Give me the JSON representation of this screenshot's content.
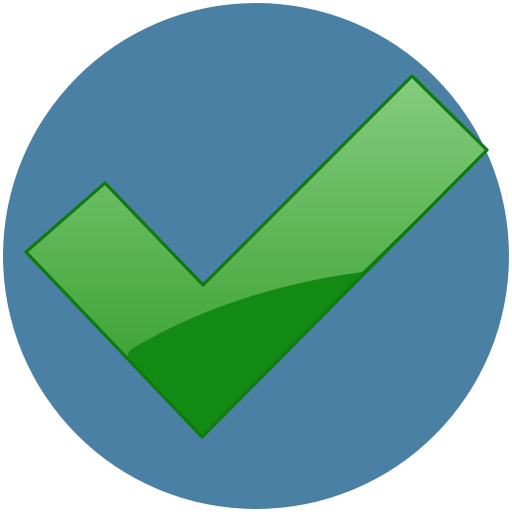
{
  "icon": {
    "name": "checkmark-icon",
    "colors": {
      "circle_fill": "#4a80a4",
      "check_light": "#86cc80",
      "check_mid": "#55b04c",
      "check_dark": "#138a14",
      "check_outline": "#0e7a10",
      "page_background": "#ffffff"
    }
  }
}
